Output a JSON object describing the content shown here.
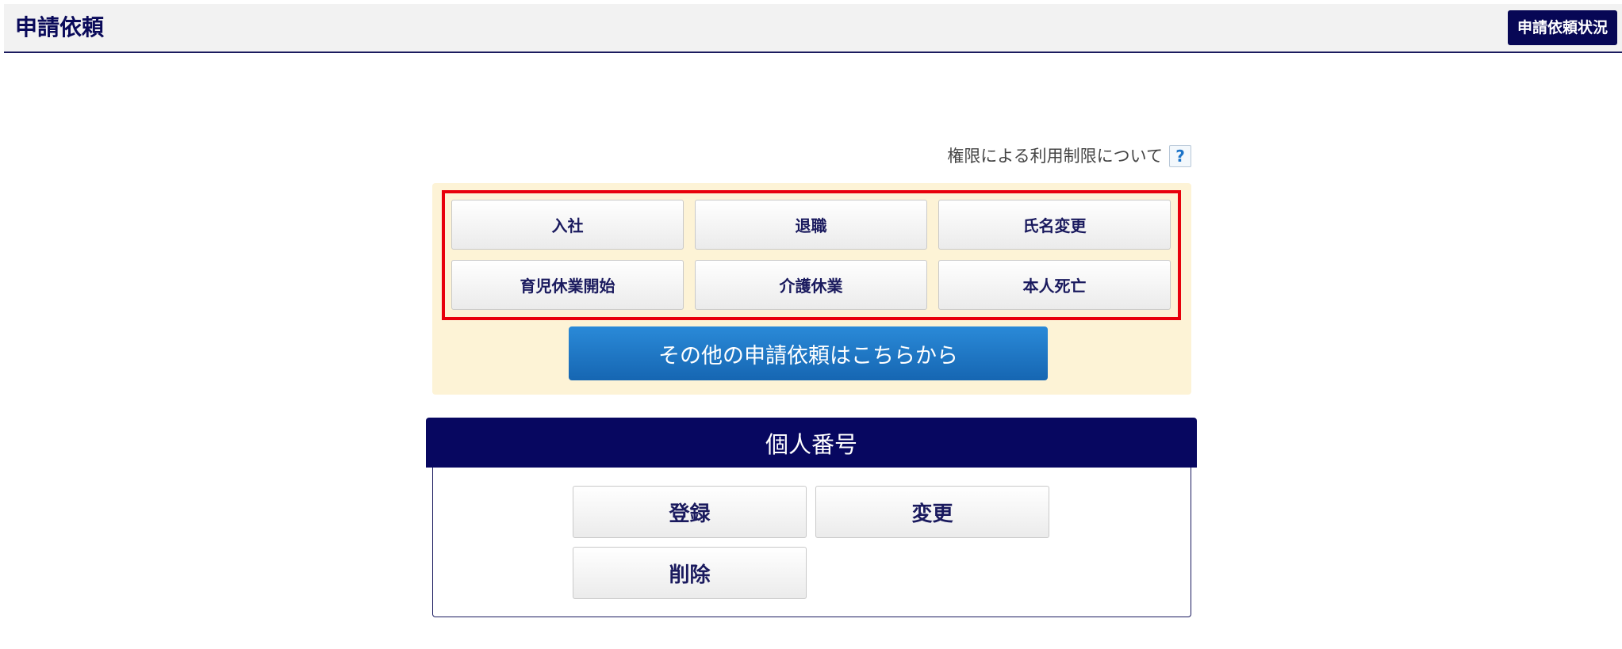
{
  "header": {
    "title": "申請依頼",
    "status_button": "申請依頼状況"
  },
  "permission_note": {
    "text": "権限による利用制限について",
    "help_icon": "?"
  },
  "request_buttons": [
    "入社",
    "退職",
    "氏名変更",
    "育児休業開始",
    "介護休業",
    "本人死亡"
  ],
  "other_requests_button": "その他の申請依頼はこちらから",
  "my_number": {
    "title": "個人番号",
    "buttons": [
      "登録",
      "変更",
      "削除"
    ]
  },
  "colors": {
    "navy": "#070760",
    "highlight": "#e8000b",
    "panel_bg": "#fdf3d6",
    "blue_button": "#1b78c8"
  }
}
